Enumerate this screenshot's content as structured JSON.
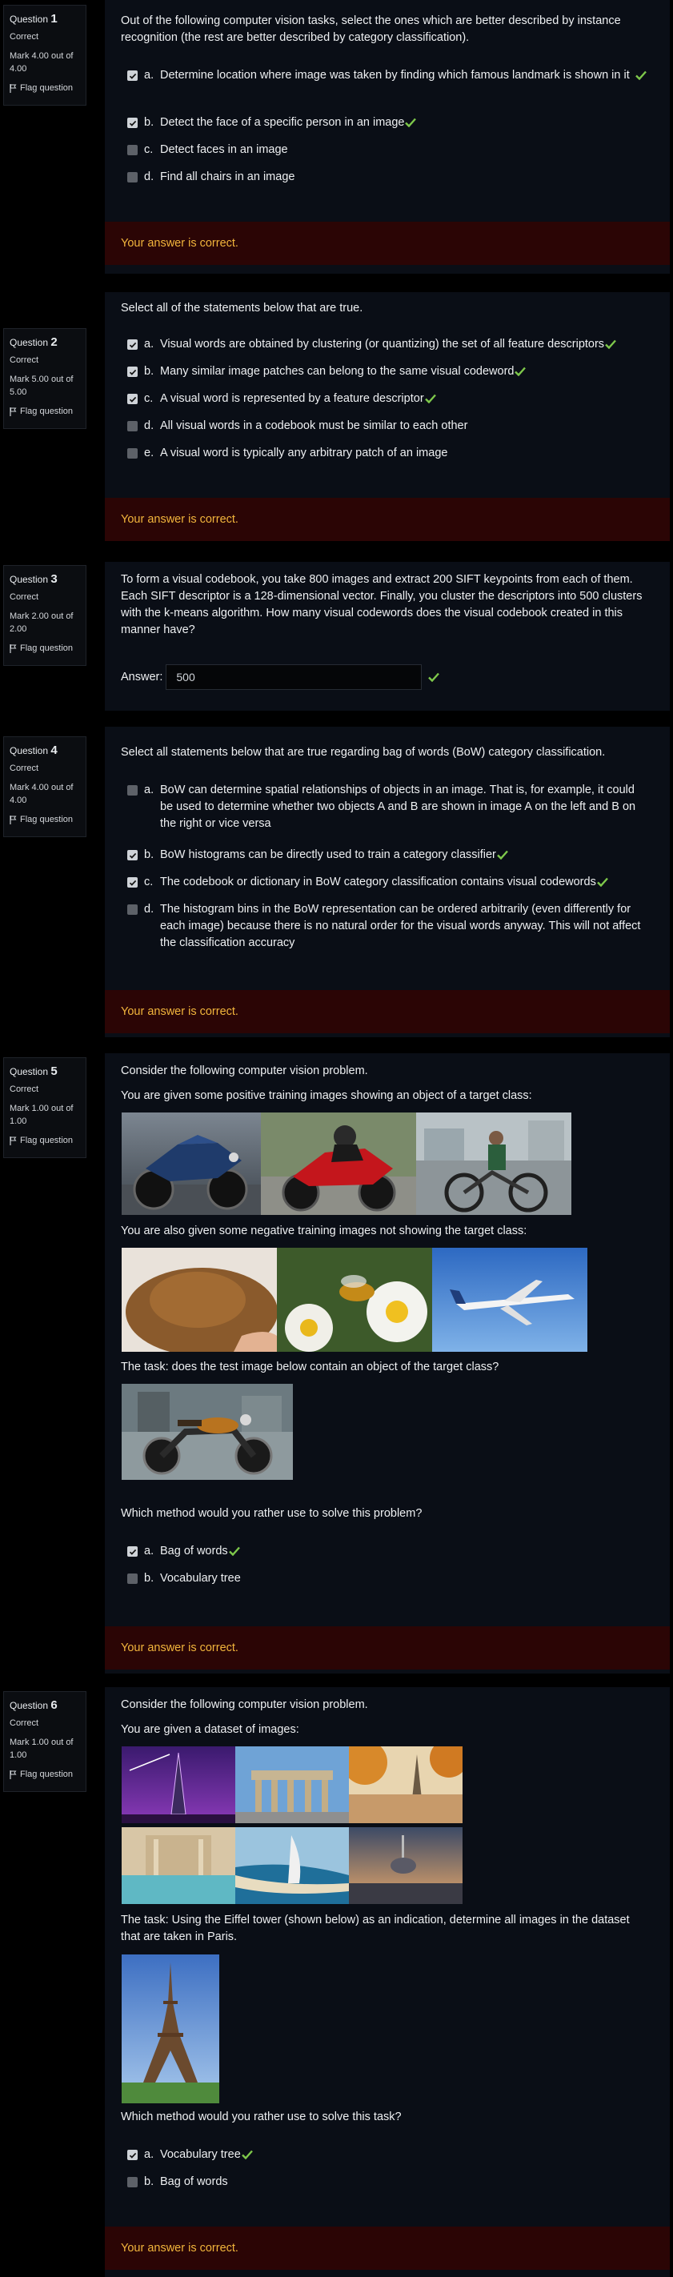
{
  "questions": [
    {
      "number_label": "Question",
      "number": "1",
      "state": "Correct",
      "grade": "Mark 4.00 out of 4.00",
      "flag": "Flag question",
      "text": "Out of the following computer vision tasks, select the ones which are better described by instance recognition (the rest are better described by category classification).",
      "options": [
        {
          "letter": "a.",
          "text": "Determine location where image was taken by finding which famous landmark is shown in it",
          "checked": true
        },
        {
          "letter": "b.",
          "text": "Detect the face of a specific person in an image",
          "checked": true
        },
        {
          "letter": "c.",
          "text": "Detect faces in an image",
          "checked": false
        },
        {
          "letter": "d.",
          "text": "Find all chairs in an image",
          "checked": false
        }
      ],
      "feedback": "Your answer is correct."
    },
    {
      "number_label": "Question",
      "number": "2",
      "state": "Correct",
      "grade": "Mark 5.00 out of 5.00",
      "flag": "Flag question",
      "text": "Select all of the statements below that are true.",
      "options": [
        {
          "letter": "a.",
          "text": "Visual words are obtained by clustering (or quantizing) the set of all feature descriptors",
          "checked": true
        },
        {
          "letter": "b.",
          "text": "Many similar image patches can belong to the same visual codeword",
          "checked": true
        },
        {
          "letter": "c.",
          "text": "A visual word is represented by a feature descriptor",
          "checked": true
        },
        {
          "letter": "d.",
          "text": "All visual words in a codebook must be similar to each other",
          "checked": false
        },
        {
          "letter": "e.",
          "text": "A visual word is typically any arbitrary patch of an image",
          "checked": false
        }
      ],
      "feedback": "Your answer is correct."
    },
    {
      "number_label": "Question",
      "number": "3",
      "state": "Correct",
      "grade": "Mark 2.00 out of 2.00",
      "flag": "Flag question",
      "text": "To form a visual codebook, you take 800 images and extract 200 SIFT keypoints from each of them. Each SIFT descriptor is a 128-dimensional vector. Finally, you cluster the descriptors into 500 clusters with the k-means algorithm. How many visual codewords does the visual codebook created in this manner have?",
      "answer_label": "Answer:",
      "answer_value": "500"
    },
    {
      "number_label": "Question",
      "number": "4",
      "state": "Correct",
      "grade": "Mark 4.00 out of 4.00",
      "flag": "Flag question",
      "text": "Select all statements below that are true regarding bag of words (BoW) category classification.",
      "options": [
        {
          "letter": "a.",
          "text": "BoW can determine spatial relationships of objects in an image. That is, for example, it could be used to determine whether two objects A and B are shown in image A on the left and B on the right or vice versa",
          "checked": false
        },
        {
          "letter": "b.",
          "text": "BoW histograms can be directly used to train a category classifier",
          "checked": true
        },
        {
          "letter": "c.",
          "text": "The codebook or dictionary in BoW category classification contains visual codewords",
          "checked": true
        },
        {
          "letter": "d.",
          "text": "The histogram bins in the BoW representation can be ordered arbitrarily (even differently for each image) because there is no natural order for the visual words anyway. This will not affect the classification accuracy",
          "checked": false
        }
      ],
      "feedback": "Your answer is correct."
    },
    {
      "number_label": "Question",
      "number": "5",
      "state": "Correct",
      "grade": "Mark 1.00 out of 1.00",
      "flag": "Flag question",
      "text": "Consider the following computer vision problem.",
      "text_positive": "You are given some positive training images showing an object of a target class:",
      "text_negative": "You are also given some negative training images not showing the target class:",
      "text_task": "The task: does the test image below contain an object of the target class?",
      "text_method": "Which method would you rather use to solve this problem?",
      "options": [
        {
          "letter": "a.",
          "text": "Bag of words",
          "checked": true
        },
        {
          "letter": "b.",
          "text": "Vocabulary tree",
          "checked": false
        }
      ],
      "feedback": "Your answer is correct."
    },
    {
      "number_label": "Question",
      "number": "6",
      "state": "Correct",
      "grade": "Mark 1.00 out of 1.00",
      "flag": "Flag question",
      "text": "Consider the following computer vision problem.",
      "text_dataset": "You are given a dataset of images:",
      "text_task": "The task: Using the Eiffel tower (shown below)  as an indication, determine all images in the dataset that are taken in Paris.",
      "text_method": "Which method would you rather use to solve this task?",
      "options": [
        {
          "letter": "a.",
          "text": "Vocabulary tree",
          "checked": true
        },
        {
          "letter": "b.",
          "text": "Bag of words",
          "checked": false
        }
      ],
      "feedback": "Your answer is correct."
    }
  ],
  "icons": {
    "tick_color": "#7ec84b",
    "flag": "flag-icon",
    "correct": "check-icon"
  },
  "colors": {
    "feedback_bg": "#2b0505",
    "feedback_text": "#f2b53c",
    "content_bg": "#0a0e16"
  }
}
